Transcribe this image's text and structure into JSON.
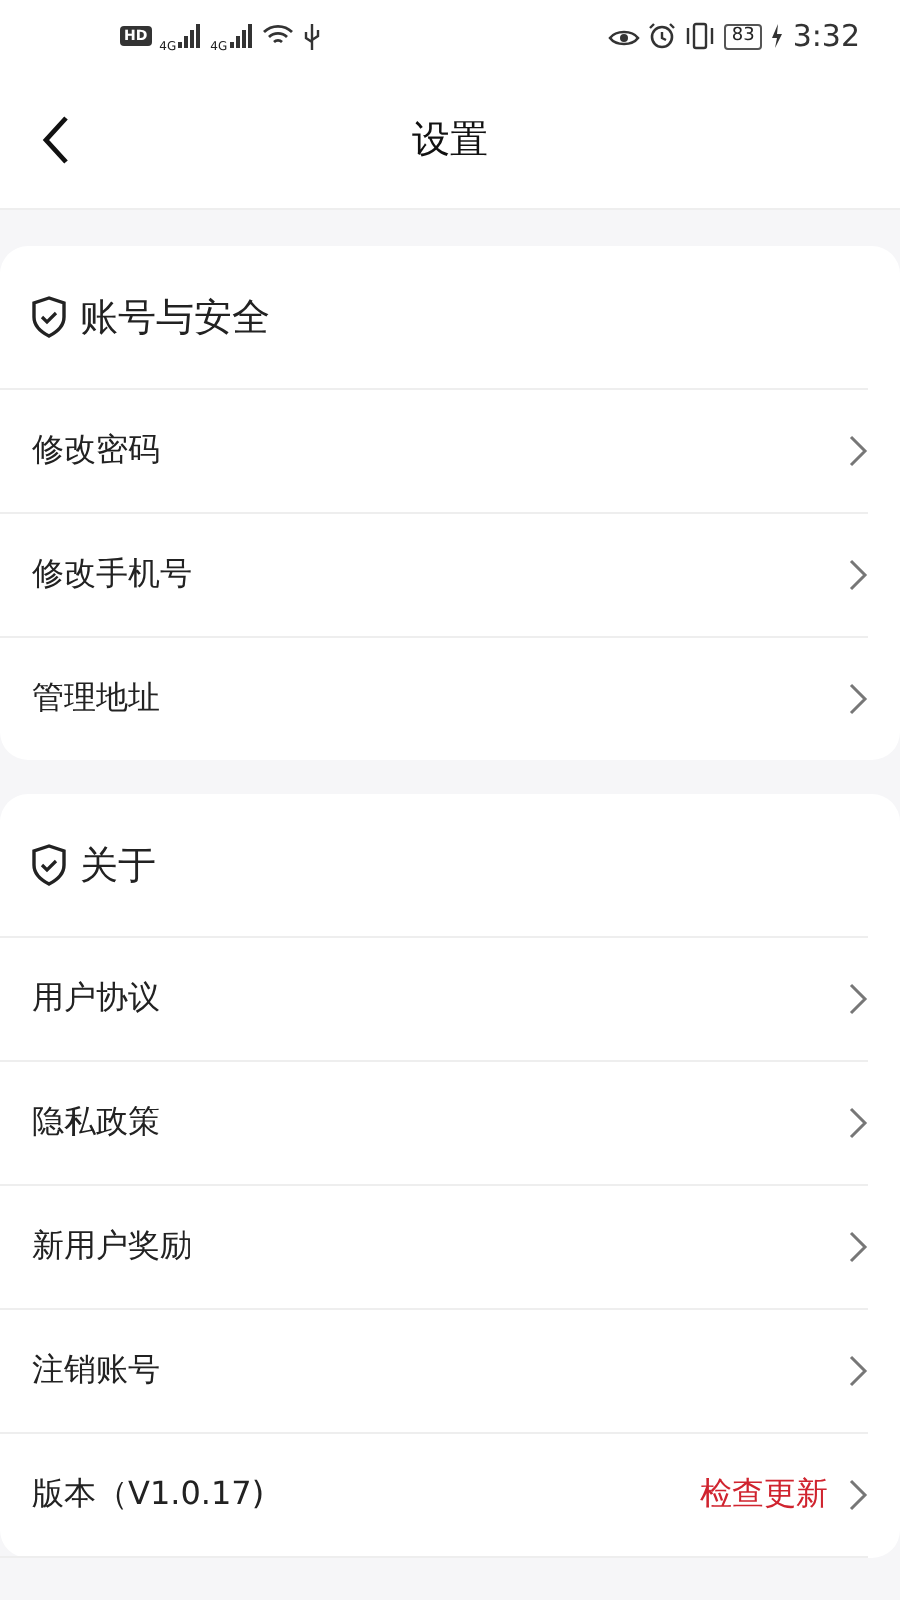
{
  "status_bar": {
    "hd": "HD",
    "networks": [
      "4G",
      "4G"
    ],
    "battery": "83",
    "time": "3:32"
  },
  "header": {
    "title": "设置"
  },
  "sections": [
    {
      "title": "账号与安全",
      "items": [
        {
          "label": "修改密码"
        },
        {
          "label": "修改手机号"
        },
        {
          "label": "管理地址"
        }
      ]
    },
    {
      "title": "关于",
      "items": [
        {
          "label": "用户协议"
        },
        {
          "label": "隐私政策"
        },
        {
          "label": "新用户奖励"
        },
        {
          "label": "注销账号"
        },
        {
          "label": "版本（V1.0.17)",
          "action": "检查更新"
        }
      ]
    }
  ]
}
